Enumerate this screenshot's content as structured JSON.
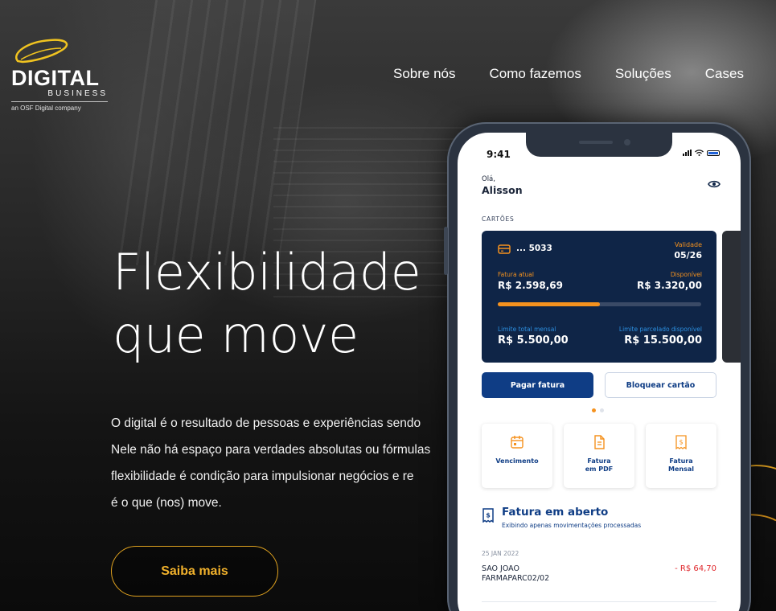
{
  "brand": {
    "word": "DIGITAL",
    "sub": "BUSINESS",
    "tagline": "an OSF Digital company",
    "accent": "#e0a21f"
  },
  "nav": {
    "items": [
      "Sobre nós",
      "Como fazemos",
      "Soluções",
      "Cases"
    ]
  },
  "hero": {
    "title_line1": "Flexibilidade",
    "title_line2": "que move",
    "text_lines": [
      "O digital é o resultado de pessoas e experiências sendo",
      "Nele não há espaço para verdades absolutas ou fórmulas",
      "flexibilidade é condição para impulsionar negócios e re",
      "é o que (nos) move."
    ],
    "cta": "Saiba mais"
  },
  "phone": {
    "status_time": "9:41",
    "greeting": "Olá,",
    "user_name": "Alisson",
    "cards_label": "CARTÕES",
    "card": {
      "number": "... 5033",
      "validity_label": "Validade",
      "validity": "05/26",
      "current_bill_label": "Fatura atual",
      "current_bill": "R$ 2.598,69",
      "available_label": "Disponível",
      "available": "R$ 3.320,00",
      "usage_fraction": 0.5,
      "monthly_limit_label": "Limite total mensal",
      "monthly_limit": "R$ 5.500,00",
      "installment_limit_label": "Limite parcelado disponível",
      "installment_limit": "R$ 15.500,00"
    },
    "buttons": {
      "pay": "Pagar fatura",
      "block": "Bloquear cartão"
    },
    "quick_actions": [
      {
        "label": "Vencimento",
        "icon": "calendar-icon"
      },
      {
        "label": "Fatura\nem PDF",
        "icon": "document-icon"
      },
      {
        "label": "Fatura\nMensal",
        "icon": "receipt-icon"
      }
    ],
    "open_bill": {
      "title": "Fatura em aberto",
      "subtitle": "Exibindo apenas movimentações processadas"
    },
    "transactions": [
      {
        "date": "25 JAN 2022",
        "desc_line1": "SAO JOAO",
        "desc_line2": "FARMAPARC02/02",
        "amount": "- R$ 64,70"
      }
    ],
    "colors": {
      "primary": "#0f3d85",
      "card": "#0f2547",
      "orange": "#f5921e",
      "negative": "#e0262b"
    }
  }
}
